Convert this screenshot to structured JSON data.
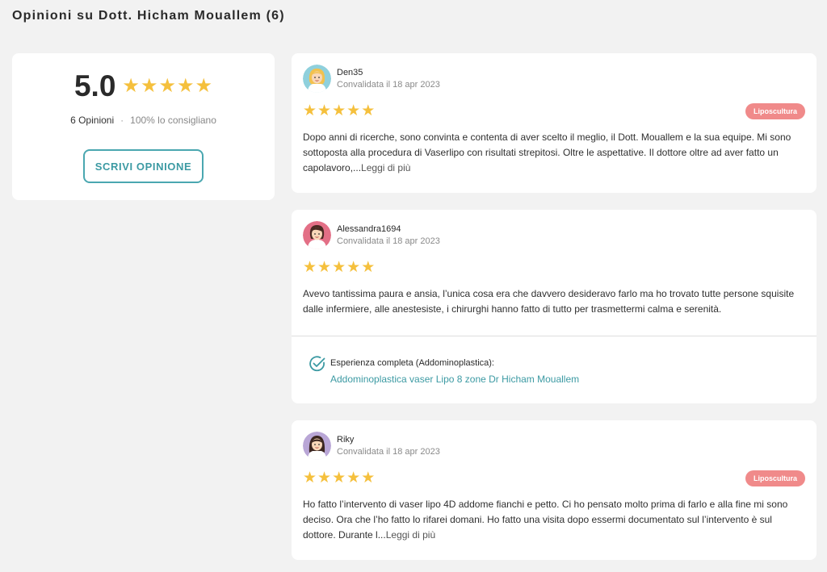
{
  "page": {
    "title": "Opinioni su Dott. Hicham Mouallem (6)"
  },
  "summary": {
    "score": "5.0",
    "rating": 5,
    "count_label": "6 Opinioni",
    "separator": "·",
    "recommend_label": "100% lo consigliano",
    "write_button": "SCRIVI OPINIONE"
  },
  "colors": {
    "star": "#f5c03d",
    "accent": "#3c9aa3",
    "badge": "#f08a8a"
  },
  "reviews": [
    {
      "author": "Den35",
      "date": "Convalidata il 18 apr 2023",
      "rating": 5,
      "badge": "Liposcultura",
      "text": "Dopo anni di ricerche, sono convinta e contenta di aver scelto il meglio, il Dott. Mouallem e la sua equipe. Mi sono sottoposta alla procedura di Vaserlipo con risultati strepitosi. Oltre le aspettative. Il dottore oltre ad aver fatto un capolavoro,...",
      "more": "Leggi di più",
      "avatar_icon": "woman-blonde-avatar"
    },
    {
      "author": "Alessandra1694",
      "date": "Convalidata il 18 apr 2023",
      "rating": 5,
      "text": "Avevo tantissima paura e ansia, l’unica cosa era che davvero desideravo farlo ma ho trovato tutte persone squisite dalle infermiere, alle anestesiste, i chirurghi hanno fatto di tutto per trasmettermi calma e serenità.",
      "experience_label": "Esperienza completa (Addominoplastica):",
      "experience_link": "Addominoplastica vaser Lipo 8 zone Dr Hicham Mouallem",
      "avatar_icon": "woman-dark-hair-avatar"
    },
    {
      "author": "Riky",
      "date": "Convalidata il 18 apr 2023",
      "rating": 5,
      "badge": "Liposcultura",
      "text": "Ho fatto l’intervento di vaser lipo 4D addome fianchi e petto. Ci ho pensato molto prima di farlo e alla fine mi sono deciso. Ora che l’ho fatto lo rifarei domani. Ho fatto una visita dopo essermi documentato sul l’intervento è sul dottore. Durante l...",
      "more": "Leggi di più",
      "avatar_icon": "woman-long-hair-avatar"
    }
  ]
}
